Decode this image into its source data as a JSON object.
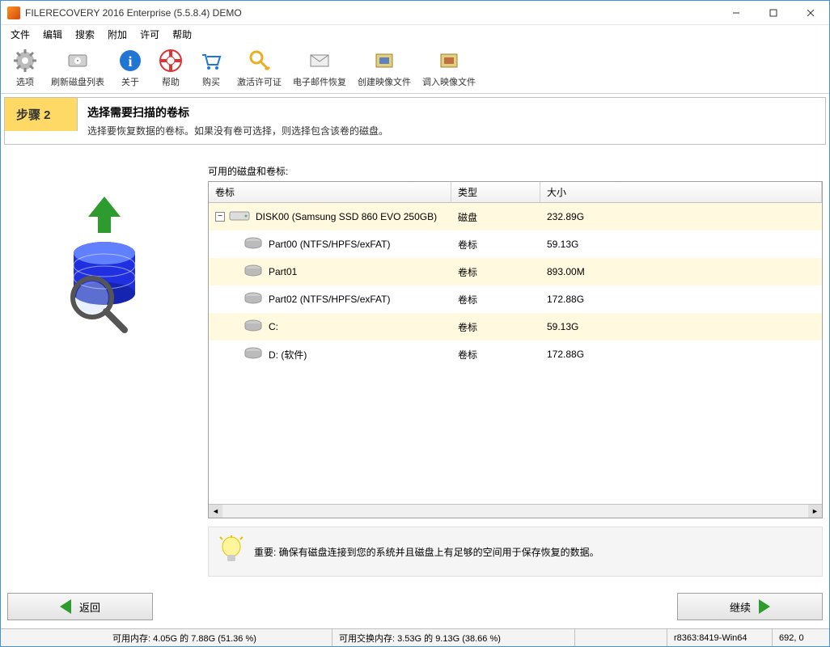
{
  "window": {
    "title": "FILERECOVERY 2016 Enterprise (5.5.8.4) DEMO"
  },
  "menu": {
    "items": [
      "文件",
      "编辑",
      "搜索",
      "附加",
      "许可",
      "帮助"
    ]
  },
  "toolbar": {
    "items": [
      {
        "name": "options",
        "label": "选项",
        "icon": "gear"
      },
      {
        "name": "refresh-disks",
        "label": "刷新磁盘列表",
        "icon": "drive"
      },
      {
        "name": "about",
        "label": "关于",
        "icon": "info"
      },
      {
        "name": "help",
        "label": "帮助",
        "icon": "lifebuoy"
      },
      {
        "name": "buy",
        "label": "购买",
        "icon": "cart"
      },
      {
        "name": "activate",
        "label": "激活许可证",
        "icon": "key"
      },
      {
        "name": "email-recovery",
        "label": "电子邮件恢复",
        "icon": "mail"
      },
      {
        "name": "create-image",
        "label": "创建映像文件",
        "icon": "image-create"
      },
      {
        "name": "load-image",
        "label": "调入映像文件",
        "icon": "image-load"
      }
    ]
  },
  "step": {
    "badge": "步骤 2",
    "title": "选择需要扫描的卷标",
    "desc": "选择要恢复数据的卷标。如果没有卷可选择，则选择包含该卷的磁盘。"
  },
  "panel": {
    "caption": "可用的磁盘和卷标:",
    "columns": {
      "label": "卷标",
      "type": "类型",
      "size": "大小"
    },
    "rows": [
      {
        "kind": "disk",
        "indent": 0,
        "highlight": true,
        "expand": "−",
        "label": "DISK00 (Samsung SSD 860 EVO 250GB)",
        "type": "磁盘",
        "size": "232.89G"
      },
      {
        "kind": "part",
        "indent": 1,
        "highlight": false,
        "label": "Part00 (NTFS/HPFS/exFAT)",
        "type": "卷标",
        "size": "59.13G"
      },
      {
        "kind": "part",
        "indent": 1,
        "highlight": true,
        "label": "Part01",
        "type": "卷标",
        "size": "893.00M"
      },
      {
        "kind": "part",
        "indent": 1,
        "highlight": false,
        "label": "Part02 (NTFS/HPFS/exFAT)",
        "type": "卷标",
        "size": "172.88G"
      },
      {
        "kind": "part",
        "indent": 1,
        "highlight": true,
        "label": "C:",
        "type": "卷标",
        "size": "59.13G"
      },
      {
        "kind": "part",
        "indent": 1,
        "highlight": false,
        "label": "D: (软件)",
        "type": "卷标",
        "size": "172.88G"
      }
    ]
  },
  "tip": {
    "text": "重要: 确保有磁盘连接到您的系统并且磁盘上有足够的空间用于保存恢复的数据。"
  },
  "nav": {
    "back": "返回",
    "next": "继续"
  },
  "status": {
    "mem": "可用内存: 4.05G 的 7.88G (51.36 %)",
    "swap": "可用交换内存: 3.53G 的 9.13G (38.66 %)",
    "build": "r8363:8419-Win64",
    "coords": "692, 0"
  }
}
